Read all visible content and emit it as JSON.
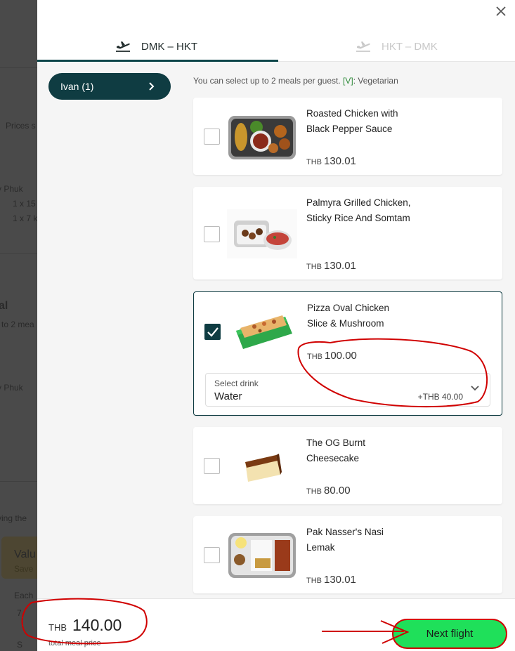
{
  "background_fragments": [
    "Prices s",
    "y  Phuk",
    "1 x 15",
    "1 x 7 k",
    "al",
    "to 2 mea",
    "y  Phuk",
    "ying the",
    "Valu",
    "Save",
    "Each",
    "7",
    "S"
  ],
  "modal": {
    "close_label": "×",
    "tabs": [
      {
        "label": "DMK – HKT",
        "icon": "plane-takeoff-icon",
        "active": true
      },
      {
        "label": "HKT – DMK",
        "icon": "plane-takeoff-icon",
        "active": false
      }
    ]
  },
  "guest": {
    "label": "Ivan (1)"
  },
  "hint": {
    "text": "You can select up to 2 meals per guest.",
    "veg_code": "[V]",
    "veg_label": ": Vegetarian"
  },
  "meals": [
    {
      "name": "Roasted Chicken with Black Pepper Sauce",
      "currency": "THB",
      "price": "130.01",
      "selected": false
    },
    {
      "name": "Palmyra Grilled Chicken, Sticky Rice And Somtam",
      "currency": "THB",
      "price": "130.01",
      "selected": false
    },
    {
      "name": "Pizza Oval Chicken Slice & Mushroom",
      "currency": "THB",
      "price": "100.00",
      "selected": true
    },
    {
      "name": "The OG Burnt Cheesecake",
      "currency": "THB",
      "price": "80.00",
      "selected": false
    },
    {
      "name": "Pak Nasser's Nasi Lemak",
      "currency": "THB",
      "price": "130.01",
      "selected": false
    }
  ],
  "drink": {
    "label": "Select drink",
    "value": "Water",
    "extra": "+THB 40.00"
  },
  "footer": {
    "currency": "THB",
    "total": "140.00",
    "total_label": "total meal price",
    "next_label": "Next flight"
  },
  "colors": {
    "primary": "#0f3c42",
    "next_button": "#1fe05a",
    "annotation": "#d00000",
    "veg": "#2e8b3a"
  }
}
